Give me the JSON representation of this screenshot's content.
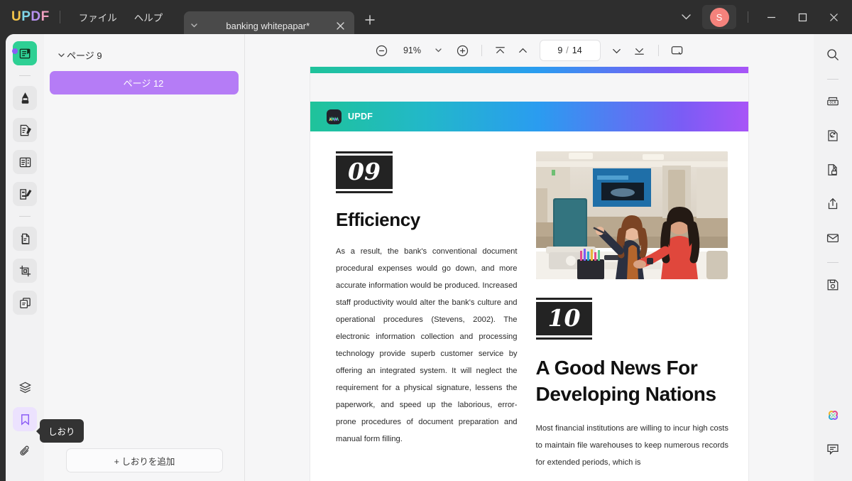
{
  "app": {
    "name": "UPDF",
    "logo_letters": [
      "U",
      "P",
      "D",
      "F"
    ],
    "accent_purple": "#8b5cf6",
    "accent_green": "#2ed094",
    "avatar_color": "#f4827c"
  },
  "titlebar": {
    "menus": [
      {
        "label": "ファイル",
        "name": "menu-file"
      },
      {
        "label": "ヘルプ",
        "name": "menu-help"
      }
    ],
    "tabs": [
      {
        "label": "banking whitepapar*",
        "active": true
      }
    ],
    "new_tab_label": "+",
    "chevron_label": "⌄",
    "avatar_initial": "S",
    "window_controls": {
      "minimize": "—",
      "maximize": "▢",
      "close": "✕"
    }
  },
  "left_rail": {
    "items": [
      {
        "name": "reader-icon",
        "label": "リーダー",
        "active": true
      },
      {
        "name": "marker-icon",
        "label": "マーカー"
      },
      {
        "name": "edit-pdf-icon",
        "label": "PDFを編集"
      },
      {
        "name": "page-organize-icon",
        "label": "ページ整理"
      },
      {
        "name": "annotate-icon",
        "label": "注釈"
      },
      {
        "name": "convert-icon",
        "label": "変換"
      },
      {
        "name": "crop-icon",
        "label": "トリミング"
      },
      {
        "name": "compare-icon",
        "label": "比較"
      }
    ],
    "bottom_items": [
      {
        "name": "layers-icon",
        "label": "レイヤー"
      },
      {
        "name": "bookmark-icon",
        "label": "しおり",
        "active": true
      },
      {
        "name": "attachment-icon",
        "label": "添付ファイル"
      }
    ],
    "tooltip": "しおり"
  },
  "bookmark_panel": {
    "items": [
      {
        "label": "ページ 9",
        "expanded": true,
        "selected": false
      },
      {
        "label": "ページ 12",
        "expanded": false,
        "selected": true
      }
    ],
    "add_button": "+ しおりを追加"
  },
  "toolbar": {
    "zoom_out": "−",
    "zoom_value": "91%",
    "zoom_caret": "▾",
    "zoom_in": "+",
    "first_page": "first-page",
    "prev_page": "prev-page",
    "page_current": "9",
    "page_separator": "/",
    "page_total": "14",
    "next_page": "next-page",
    "last_page": "last-page",
    "presentation": "presentation-mode"
  },
  "document": {
    "header_brand": "UPDF",
    "gradient": [
      "#1fc39a",
      "#22b8c9",
      "#2a9cf0",
      "#7b5cf5",
      "#a855f7"
    ],
    "sections": [
      {
        "number": "09",
        "title": "Efficiency",
        "body": "As a result, the bank's conventional document procedural expenses would go down, and more accurate information would be produced. Increased staff productivity would alter the bank's culture and operational procedures (Stevens, 2002). The electronic information collection and processing technology provide superb customer service by offering an integrated system. It will neglect the requirement for a physical signature, lessens the paperwork, and speed up the laborious, error-prone procedures of document preparation and manual form filling."
      },
      {
        "number": "10",
        "title": "A Good News For Developing Nations",
        "body": "Most financial institutions are willing to incur high costs to maintain file warehouses to keep numerous records for extended periods, which is"
      }
    ],
    "photo_alt": "Two women reviewing documents at an office desk with a monitor"
  },
  "right_rail": {
    "items": [
      {
        "name": "search-icon",
        "label": "検索"
      },
      {
        "name": "ocr-icon",
        "label": "OCR"
      },
      {
        "name": "convert-file-icon",
        "label": "変換"
      },
      {
        "name": "protect-icon",
        "label": "保護"
      },
      {
        "name": "share-icon",
        "label": "共有"
      },
      {
        "name": "email-icon",
        "label": "メール"
      },
      {
        "name": "save-icon",
        "label": "保存"
      }
    ],
    "bottom_items": [
      {
        "name": "ai-assistant-icon",
        "label": "AIアシスタント"
      },
      {
        "name": "comment-bubble-icon",
        "label": "コメント"
      }
    ]
  }
}
